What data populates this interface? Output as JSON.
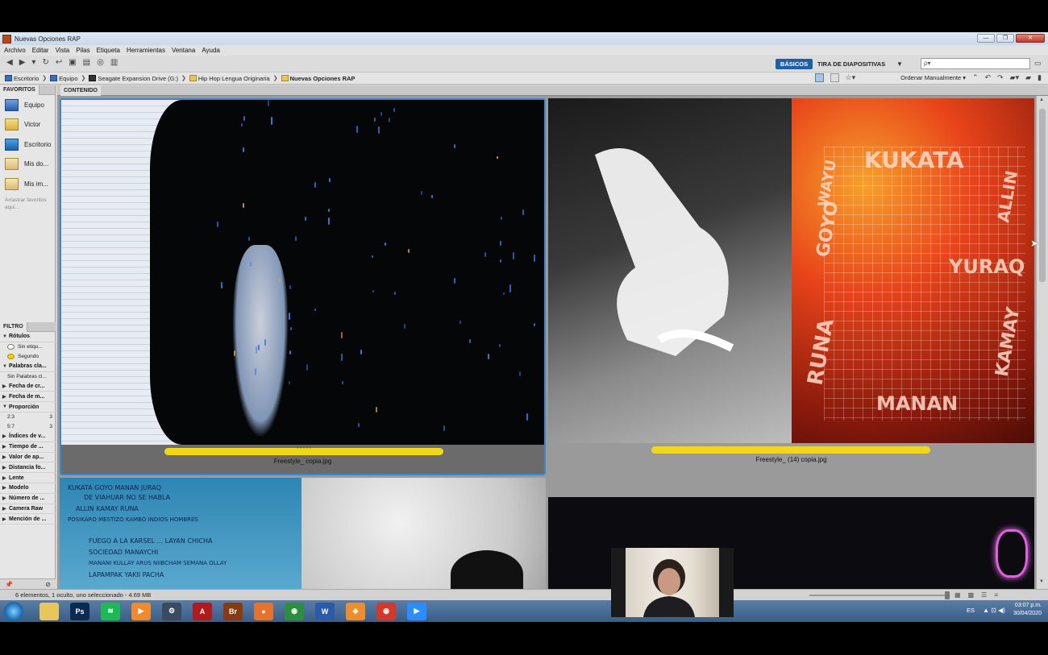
{
  "window": {
    "title": "Nuevas Opciones RAP",
    "minimize": "—",
    "maximize": "❐",
    "close": "✕"
  },
  "menu": [
    "Archivo",
    "Editar",
    "Vista",
    "Pilas",
    "Etiqueta",
    "Herramientas",
    "Ventana",
    "Ayuda"
  ],
  "toolbar": {
    "workspace_active": "BÁSICOS",
    "workspace_other": "TIRA DE DIAPOSITIVAS",
    "workspace_dropdown": "▼",
    "search_placeholder": "ρ▾"
  },
  "breadcrumb": [
    "Escritorio",
    "Equipo",
    "Seagate Expansion Drive (G:)",
    "Hip Hop Lengua Originaria",
    "Nuevas Opciones RAP"
  ],
  "sort": {
    "label": "Ordenar Manualmente ▾"
  },
  "favorites": {
    "tab": "FAVORITOS",
    "items": [
      "Equipo",
      "Victor",
      "Escritorio",
      "Mis do...",
      "Mis im..."
    ],
    "hint": "Arrastrar favoritos aquí..."
  },
  "filter": {
    "tab": "FILTRO",
    "groups": [
      {
        "name": "Rótulos",
        "open": true,
        "rows": [
          {
            "label": "Sin etiqu...",
            "count": "",
            "dot": "none"
          },
          {
            "label": "Segundo",
            "count": "",
            "dot": "yellow"
          }
        ]
      },
      {
        "name": "Palabras cla...",
        "open": true,
        "rows": [
          {
            "label": "Sin Palabras cl...",
            "count": "",
            "dot": ""
          }
        ]
      },
      {
        "name": "Fecha de cr...",
        "open": false,
        "rows": []
      },
      {
        "name": "Fecha de m...",
        "open": false,
        "rows": []
      },
      {
        "name": "Proporción",
        "open": true,
        "rows": [
          {
            "label": "2:3",
            "count": "3",
            "dot": ""
          },
          {
            "label": "5:7",
            "count": "3",
            "dot": ""
          }
        ]
      },
      {
        "name": "Índices de v...",
        "open": false,
        "rows": []
      },
      {
        "name": "Tiempo de ...",
        "open": false,
        "rows": []
      },
      {
        "name": "Valor de ap...",
        "open": false,
        "rows": []
      },
      {
        "name": "Distancia fo...",
        "open": false,
        "rows": []
      },
      {
        "name": "Lente",
        "open": false,
        "rows": []
      },
      {
        "name": "Modelo",
        "open": false,
        "rows": []
      },
      {
        "name": "Número de ...",
        "open": false,
        "rows": []
      },
      {
        "name": "Camera Raw",
        "open": false,
        "rows": []
      },
      {
        "name": "Mención de ...",
        "open": false,
        "rows": []
      }
    ]
  },
  "content": {
    "tab": "CONTENIDO",
    "thumbnails": [
      {
        "filename": "Freestyle_ copia.jpg",
        "rating_dots": "• • • • •",
        "label_color": "#f3d616",
        "selected": true
      },
      {
        "filename": "Freestyle_ (14) copia.jpg",
        "rating_dots": "",
        "label_color": "#f3d616",
        "selected": false
      }
    ],
    "graffiti": [
      "KUKATA",
      "GOYO",
      "YURAQ",
      "MANAN",
      "RUNA",
      "WAYU",
      "ALLIN",
      "KAMAY"
    ],
    "notebook_lines": [
      "KUKATA GOYO MANAN JURAQ",
      "DE VIAHUAR NO SE HABLA",
      "ALLIN KAMAY RUNA",
      "POSIKARO MESTIZO KAMBO INDIOS HOMBRES",
      "FUEGO A LA KARSEL ... LAYAN CHICHA",
      "SOCIEDAD MANAYCHI",
      "MANANI KULLAY ARUS NIIBCHAM SEMANA OLLAY",
      "LAPAMPAK YAKII PACHA"
    ]
  },
  "status": {
    "text": "6 elementos, 1 oculto, uno seleccionado - 4.69 MB"
  },
  "taskbar": {
    "apps": [
      {
        "name": "explorer",
        "glyph": "",
        "color": "#e9c65a"
      },
      {
        "name": "photoshop",
        "glyph": "Ps",
        "color": "#0b2a52"
      },
      {
        "name": "spotify",
        "glyph": "≋",
        "color": "#1db954"
      },
      {
        "name": "media",
        "glyph": "▶",
        "color": "#f08a2a"
      },
      {
        "name": "settings",
        "glyph": "⚙",
        "color": "#3b4a60"
      },
      {
        "name": "acrobat",
        "glyph": "A",
        "color": "#b11a1a"
      },
      {
        "name": "bridge",
        "glyph": "Br",
        "color": "#8a3a10"
      },
      {
        "name": "firefox",
        "glyph": "●",
        "color": "#e8722a"
      },
      {
        "name": "chrome",
        "glyph": "◉",
        "color": "#2c8e3f"
      },
      {
        "name": "word",
        "glyph": "W",
        "color": "#2a5aa8"
      },
      {
        "name": "app-orange",
        "glyph": "◈",
        "color": "#f28c28"
      },
      {
        "name": "chrome2",
        "glyph": "◉",
        "color": "#d4382a"
      },
      {
        "name": "zoom",
        "glyph": "▶",
        "color": "#2d8cff"
      }
    ],
    "lang": "ES",
    "tray_icons": "▲ ⊡ ◀)",
    "time": "03:07 p.m.",
    "date": "30/04/2020"
  }
}
